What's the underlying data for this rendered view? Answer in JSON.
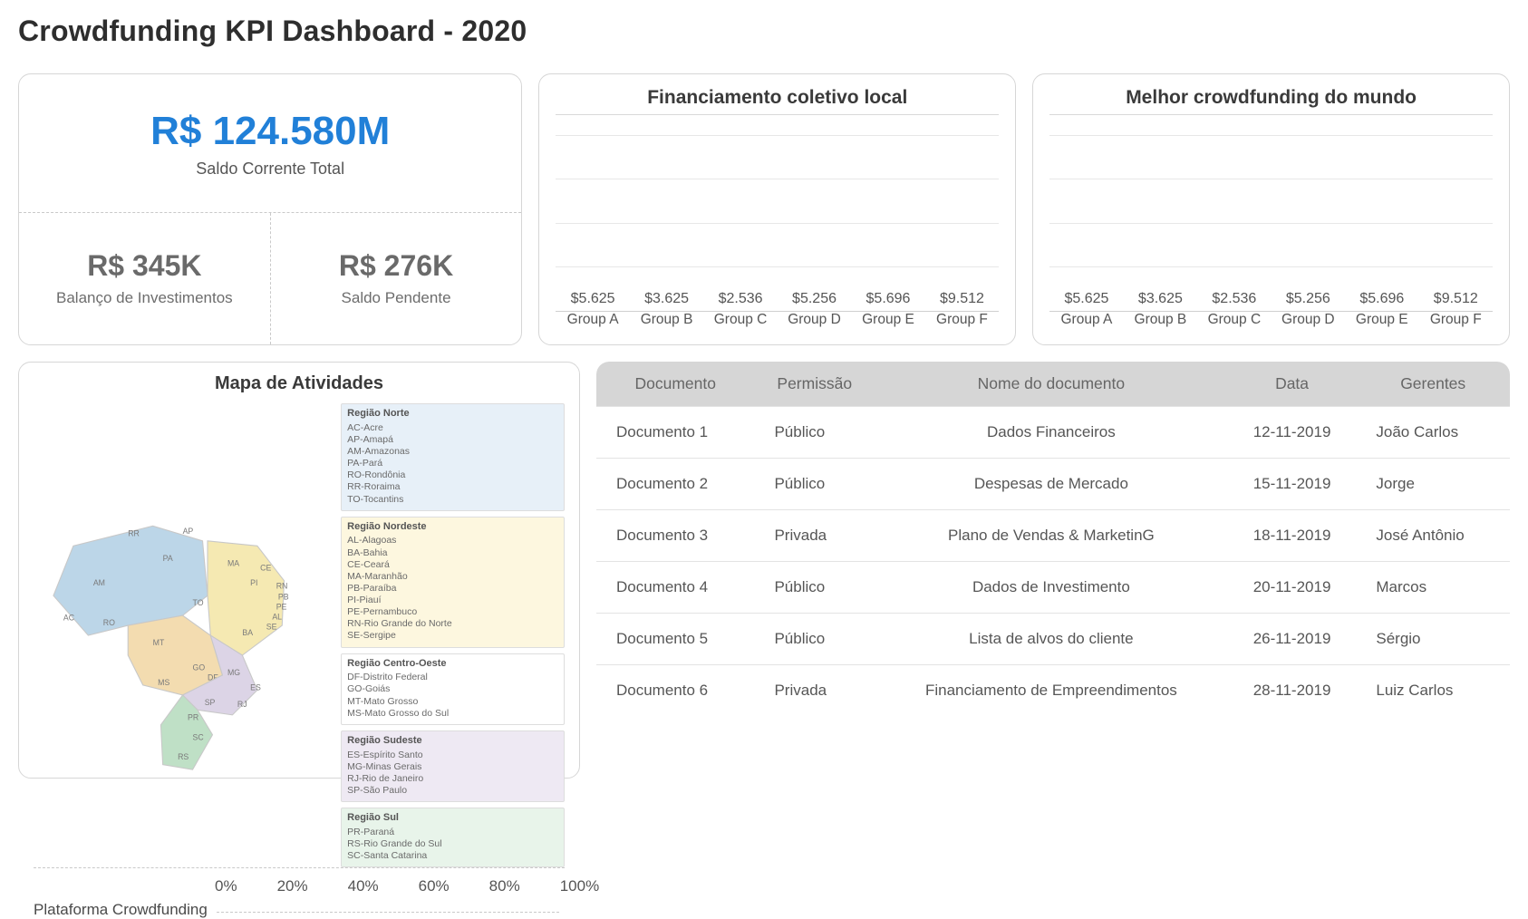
{
  "title": "Crowdfunding KPI Dashboard - 2020",
  "kpi": {
    "total_value": "R$ 124.580M",
    "total_label": "Saldo Corrente Total",
    "left_value": "R$ 345K",
    "left_label": "Balanço de Investimentos",
    "right_value": "R$ 276K",
    "right_label": "Saldo Pendente"
  },
  "chart_data": [
    {
      "type": "bar",
      "title": "Financiamento coletivo local",
      "categories": [
        "Group A",
        "Group B",
        "Group C",
        "Group D",
        "Group E",
        "Group F"
      ],
      "values": [
        5625,
        3625,
        2536,
        5256,
        5696,
        9512
      ],
      "value_labels": [
        "$5.625",
        "$3.625",
        "$2.536",
        "$5.256",
        "$5.696",
        "$9.512"
      ],
      "ylim": [
        0,
        10000
      ]
    },
    {
      "type": "bar",
      "title": "Melhor crowdfunding do mundo",
      "categories": [
        "Group A",
        "Group B",
        "Group C",
        "Group D",
        "Group E",
        "Group F"
      ],
      "values": [
        5625,
        3625,
        2536,
        5256,
        5696,
        9512
      ],
      "value_labels": [
        "$5.625",
        "$3.625",
        "$2.536",
        "$5.256",
        "$5.696",
        "$9.512"
      ],
      "ylim": [
        0,
        10000
      ]
    }
  ],
  "map": {
    "title": "Mapa de Atividades",
    "axis_ticks": [
      "0%",
      "20%",
      "40%",
      "60%",
      "80%",
      "100%"
    ],
    "platform_label": "Plataforma Crowdfunding",
    "regions": [
      {
        "name": "Região Norte",
        "class": "legend-n",
        "states": [
          "AC-Acre",
          "AP-Amapá",
          "AM-Amazonas",
          "PA-Pará",
          "RO-Rondônia",
          "RR-Roraima",
          "TO-Tocantins"
        ]
      },
      {
        "name": "Região Nordeste",
        "class": "legend-ne",
        "states": [
          "AL-Alagoas",
          "BA-Bahia",
          "CE-Ceará",
          "MA-Maranhão",
          "PB-Paraíba",
          "PI-Piauí",
          "PE-Pernambuco",
          "RN-Rio Grande do Norte",
          "SE-Sergipe"
        ]
      },
      {
        "name": "Região Centro-Oeste",
        "class": "legend-co",
        "states": [
          "DF-Distrito Federal",
          "GO-Goiás",
          "MT-Mato Grosso",
          "MS-Mato Grosso do Sul"
        ]
      },
      {
        "name": "Região Sudeste",
        "class": "legend-se",
        "states": [
          "ES-Espírito Santo",
          "MG-Minas Gerais",
          "RJ-Rio de Janeiro",
          "SP-São Paulo"
        ]
      },
      {
        "name": "Região Sul",
        "class": "legend-s",
        "states": [
          "PR-Paraná",
          "RS-Rio Grande do Sul",
          "SC-Santa Catarina"
        ]
      }
    ]
  },
  "table": {
    "headers": [
      "Documento",
      "Permissão",
      "Nome do documento",
      "Data",
      "Gerentes"
    ],
    "rows": [
      [
        "Documento 1",
        "Público",
        "Dados Financeiros",
        "12-11-2019",
        "João Carlos"
      ],
      [
        "Documento 2",
        "Público",
        "Despesas de Mercado",
        "15-11-2019",
        "Jorge"
      ],
      [
        "Documento 3",
        "Privada",
        "Plano de Vendas & MarketinG",
        "18-11-2019",
        "José Antônio"
      ],
      [
        "Documento 4",
        "Público",
        "Dados de Investimento",
        "20-11-2019",
        "Marcos"
      ],
      [
        "Documento 5",
        "Público",
        "Lista de alvos do cliente",
        "26-11-2019",
        "Sérgio"
      ],
      [
        "Documento 6",
        "Privada",
        "Financiamento de Empreendimentos",
        "28-11-2019",
        "Luiz Carlos"
      ]
    ]
  }
}
